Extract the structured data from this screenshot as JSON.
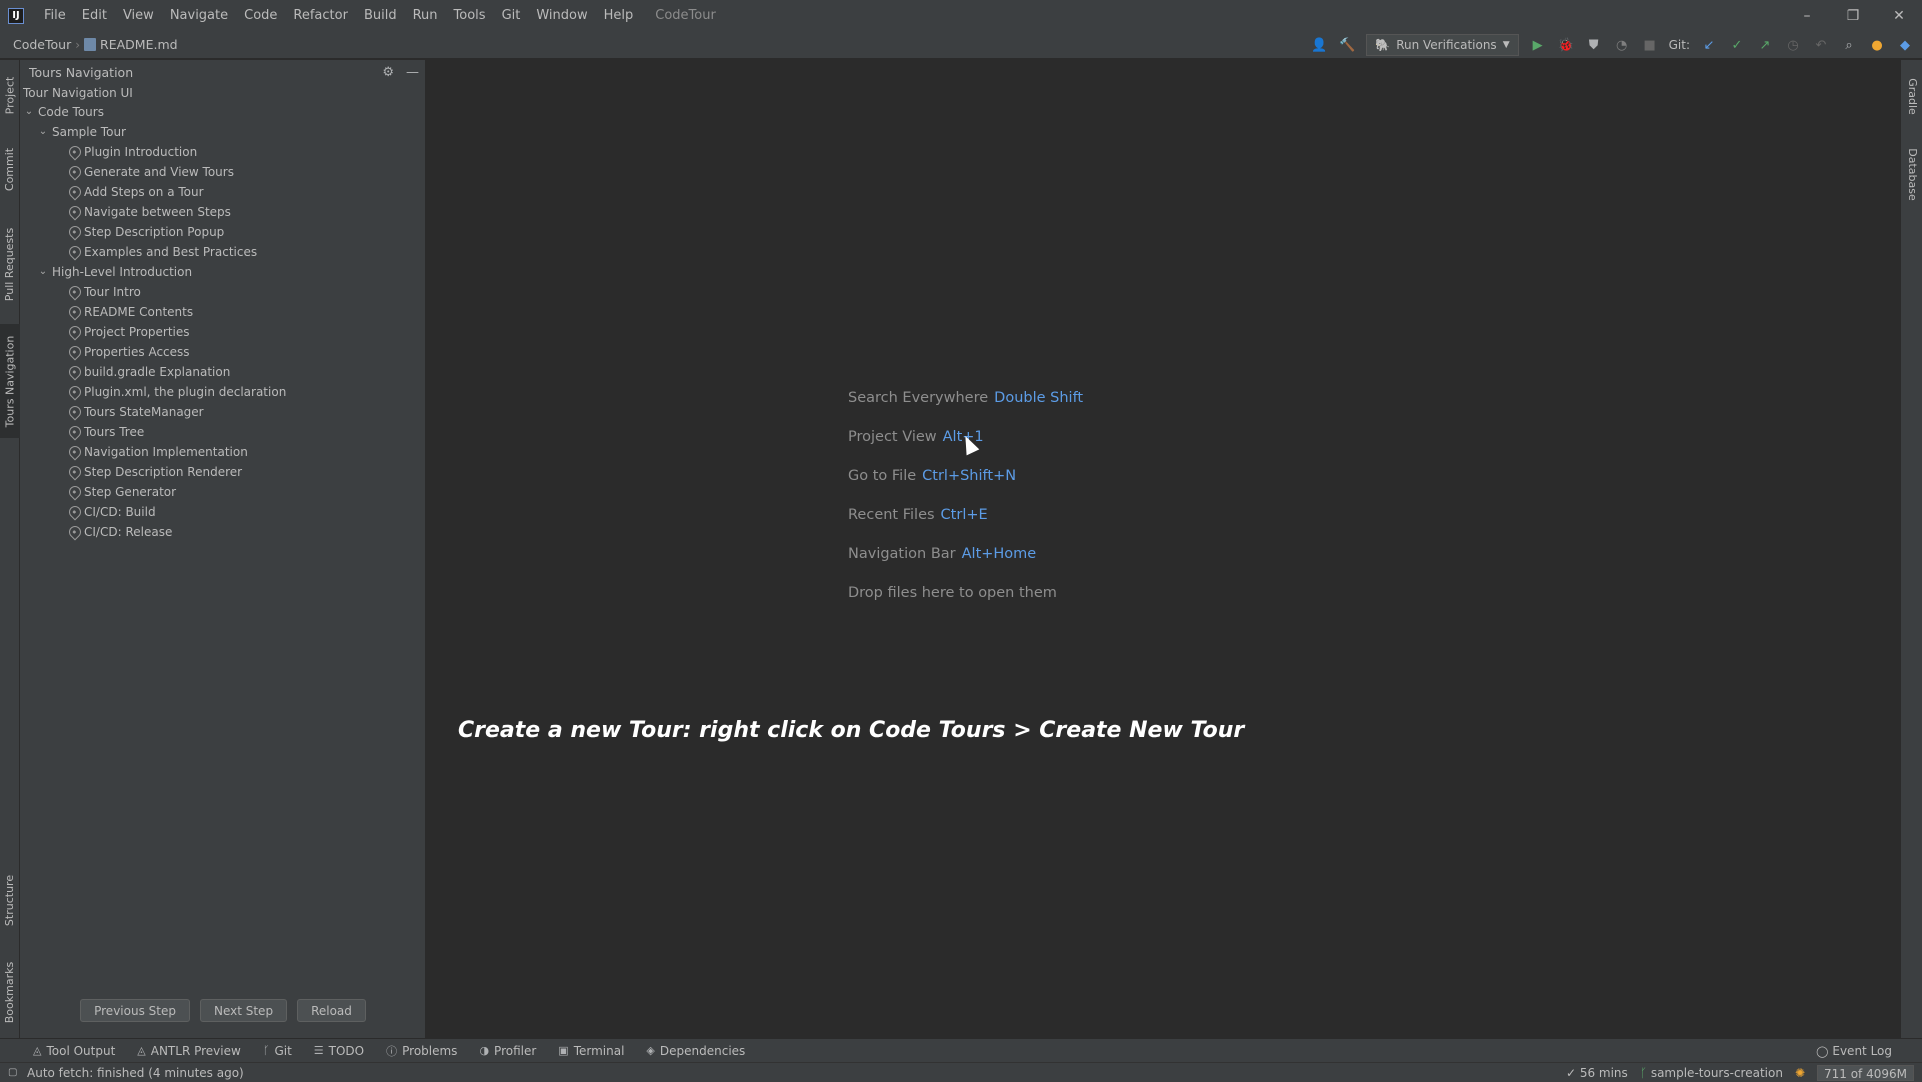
{
  "menu": {
    "items": [
      "File",
      "Edit",
      "View",
      "Navigate",
      "Code",
      "Refactor",
      "Build",
      "Run",
      "Tools",
      "Git",
      "Window",
      "Help"
    ],
    "window_title": "CodeTour"
  },
  "window_controls": {
    "minimize": "–",
    "restore": "❐",
    "close": "✕"
  },
  "navbar": {
    "project": "CodeTour",
    "file": "README.md",
    "run_config": "Run Verifications",
    "git_label": "Git:"
  },
  "left_stripe": [
    "Project",
    "Commit",
    "Pull Requests",
    "Tours Navigation",
    "Structure",
    "Bookmarks"
  ],
  "right_stripe": [
    "Gradle",
    "Database"
  ],
  "panel": {
    "title": "Tours Navigation",
    "root": "Tour Navigation UI",
    "tree": {
      "label": "Code Tours",
      "tours": [
        {
          "label": "Sample Tour",
          "steps": [
            "Plugin Introduction",
            "Generate and View Tours",
            "Add Steps on a Tour",
            "Navigate between Steps",
            "Step Description Popup",
            "Examples and Best Practices"
          ]
        },
        {
          "label": "High-Level Introduction",
          "steps": [
            "Tour Intro",
            "README Contents",
            "Project Properties",
            "Properties Access",
            "build.gradle Explanation",
            "Plugin.xml, the plugin declaration",
            "Tours StateManager",
            "Tours Tree",
            "Navigation Implementation",
            "Step Description Renderer",
            "Step Generator",
            "CI/CD: Build",
            "CI/CD: Release"
          ]
        }
      ]
    },
    "buttons": {
      "previous": "Previous Step",
      "next": "Next Step",
      "reload": "Reload"
    }
  },
  "editor": {
    "hints": [
      {
        "label": "Search Everywhere",
        "key": "Double Shift"
      },
      {
        "label": "Project View",
        "key": "Alt+1"
      },
      {
        "label": "Go to File",
        "key": "Ctrl+Shift+N"
      },
      {
        "label": "Recent Files",
        "key": "Ctrl+E"
      },
      {
        "label": "Navigation Bar",
        "key": "Alt+Home"
      },
      {
        "label": "Drop files here to open them",
        "key": ""
      }
    ],
    "promo": "Create a new Tour: right click on Code Tours > Create New Tour"
  },
  "bottom_tools": [
    "Tool Output",
    "ANTLR Preview",
    "Git",
    "TODO",
    "Problems",
    "Profiler",
    "Terminal",
    "Dependencies"
  ],
  "event_log": "Event Log",
  "status": {
    "message": "Auto fetch: finished (4 minutes ago)",
    "time": "56 mins",
    "branch": "sample-tours-creation",
    "memory": "711 of 4096M"
  },
  "colors": {
    "accent": "#5c9ce6",
    "background": "#2b2b2b",
    "panel": "#3c3f41"
  }
}
